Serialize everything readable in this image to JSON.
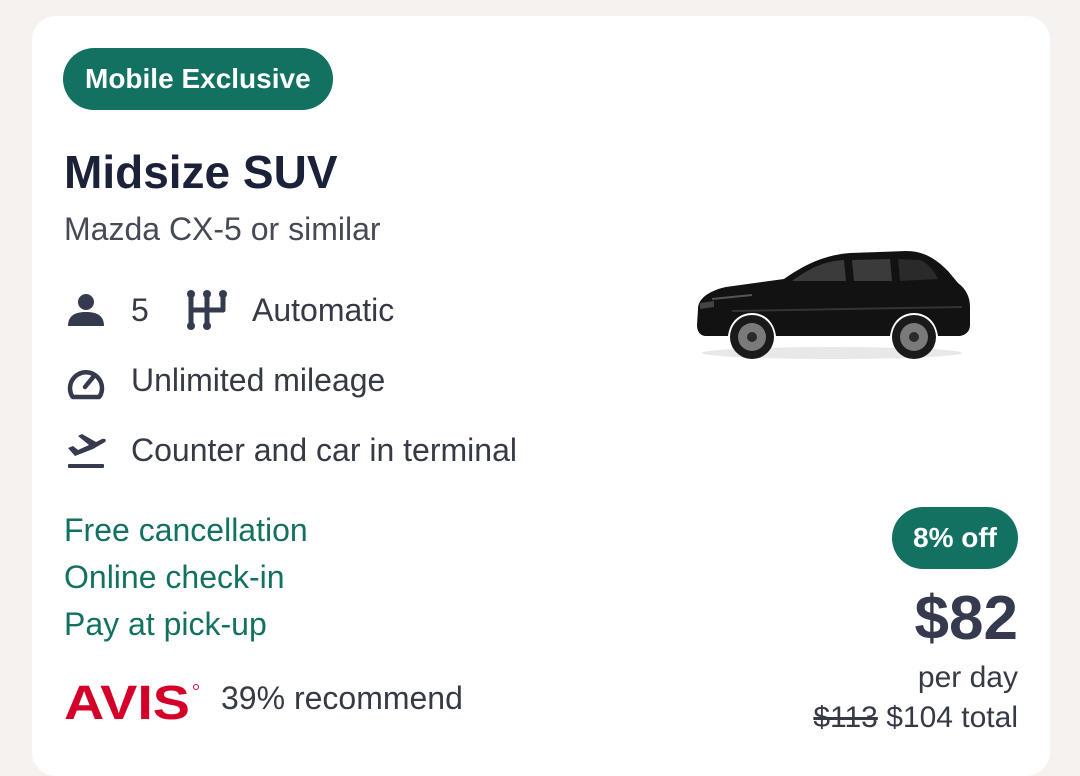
{
  "card": {
    "badge": "Mobile Exclusive",
    "title": "Midsize SUV",
    "subtitle": "Mazda CX-5 or similar",
    "features": {
      "seats": "5",
      "transmission": "Automatic",
      "mileage": "Unlimited mileage",
      "location": "Counter and car in terminal"
    },
    "benefits": [
      "Free cancellation",
      "Online check-in",
      "Pay at pick-up"
    ],
    "vendor": {
      "logo_text": "AVIS",
      "recommend": "39% recommend"
    },
    "pricing": {
      "discount": "8% off",
      "price": "$82",
      "per": "per day",
      "old_total": "$113",
      "total": "$104 total"
    },
    "icons": {
      "seats": "person-icon",
      "transmission": "gear-shift-icon",
      "mileage": "speedometer-icon",
      "location": "airplane-departure-icon"
    }
  },
  "colors": {
    "accent": "#137161",
    "title": "#1b2138",
    "text": "#353a45",
    "avis_red": "#d4002a"
  }
}
